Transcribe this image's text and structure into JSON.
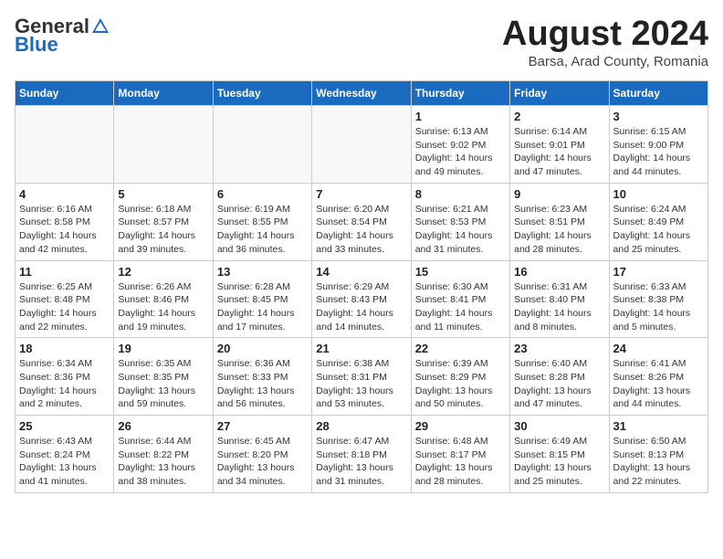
{
  "header": {
    "logo_general": "General",
    "logo_blue": "Blue",
    "month_title": "August 2024",
    "location": "Barsa, Arad County, Romania"
  },
  "columns": [
    "Sunday",
    "Monday",
    "Tuesday",
    "Wednesday",
    "Thursday",
    "Friday",
    "Saturday"
  ],
  "weeks": [
    [
      {
        "day": "",
        "info": ""
      },
      {
        "day": "",
        "info": ""
      },
      {
        "day": "",
        "info": ""
      },
      {
        "day": "",
        "info": ""
      },
      {
        "day": "1",
        "info": "Sunrise: 6:13 AM\nSunset: 9:02 PM\nDaylight: 14 hours and 49 minutes."
      },
      {
        "day": "2",
        "info": "Sunrise: 6:14 AM\nSunset: 9:01 PM\nDaylight: 14 hours and 47 minutes."
      },
      {
        "day": "3",
        "info": "Sunrise: 6:15 AM\nSunset: 9:00 PM\nDaylight: 14 hours and 44 minutes."
      }
    ],
    [
      {
        "day": "4",
        "info": "Sunrise: 6:16 AM\nSunset: 8:58 PM\nDaylight: 14 hours and 42 minutes."
      },
      {
        "day": "5",
        "info": "Sunrise: 6:18 AM\nSunset: 8:57 PM\nDaylight: 14 hours and 39 minutes."
      },
      {
        "day": "6",
        "info": "Sunrise: 6:19 AM\nSunset: 8:55 PM\nDaylight: 14 hours and 36 minutes."
      },
      {
        "day": "7",
        "info": "Sunrise: 6:20 AM\nSunset: 8:54 PM\nDaylight: 14 hours and 33 minutes."
      },
      {
        "day": "8",
        "info": "Sunrise: 6:21 AM\nSunset: 8:53 PM\nDaylight: 14 hours and 31 minutes."
      },
      {
        "day": "9",
        "info": "Sunrise: 6:23 AM\nSunset: 8:51 PM\nDaylight: 14 hours and 28 minutes."
      },
      {
        "day": "10",
        "info": "Sunrise: 6:24 AM\nSunset: 8:49 PM\nDaylight: 14 hours and 25 minutes."
      }
    ],
    [
      {
        "day": "11",
        "info": "Sunrise: 6:25 AM\nSunset: 8:48 PM\nDaylight: 14 hours and 22 minutes."
      },
      {
        "day": "12",
        "info": "Sunrise: 6:26 AM\nSunset: 8:46 PM\nDaylight: 14 hours and 19 minutes."
      },
      {
        "day": "13",
        "info": "Sunrise: 6:28 AM\nSunset: 8:45 PM\nDaylight: 14 hours and 17 minutes."
      },
      {
        "day": "14",
        "info": "Sunrise: 6:29 AM\nSunset: 8:43 PM\nDaylight: 14 hours and 14 minutes."
      },
      {
        "day": "15",
        "info": "Sunrise: 6:30 AM\nSunset: 8:41 PM\nDaylight: 14 hours and 11 minutes."
      },
      {
        "day": "16",
        "info": "Sunrise: 6:31 AM\nSunset: 8:40 PM\nDaylight: 14 hours and 8 minutes."
      },
      {
        "day": "17",
        "info": "Sunrise: 6:33 AM\nSunset: 8:38 PM\nDaylight: 14 hours and 5 minutes."
      }
    ],
    [
      {
        "day": "18",
        "info": "Sunrise: 6:34 AM\nSunset: 8:36 PM\nDaylight: 14 hours and 2 minutes."
      },
      {
        "day": "19",
        "info": "Sunrise: 6:35 AM\nSunset: 8:35 PM\nDaylight: 13 hours and 59 minutes."
      },
      {
        "day": "20",
        "info": "Sunrise: 6:36 AM\nSunset: 8:33 PM\nDaylight: 13 hours and 56 minutes."
      },
      {
        "day": "21",
        "info": "Sunrise: 6:38 AM\nSunset: 8:31 PM\nDaylight: 13 hours and 53 minutes."
      },
      {
        "day": "22",
        "info": "Sunrise: 6:39 AM\nSunset: 8:29 PM\nDaylight: 13 hours and 50 minutes."
      },
      {
        "day": "23",
        "info": "Sunrise: 6:40 AM\nSunset: 8:28 PM\nDaylight: 13 hours and 47 minutes."
      },
      {
        "day": "24",
        "info": "Sunrise: 6:41 AM\nSunset: 8:26 PM\nDaylight: 13 hours and 44 minutes."
      }
    ],
    [
      {
        "day": "25",
        "info": "Sunrise: 6:43 AM\nSunset: 8:24 PM\nDaylight: 13 hours and 41 minutes."
      },
      {
        "day": "26",
        "info": "Sunrise: 6:44 AM\nSunset: 8:22 PM\nDaylight: 13 hours and 38 minutes."
      },
      {
        "day": "27",
        "info": "Sunrise: 6:45 AM\nSunset: 8:20 PM\nDaylight: 13 hours and 34 minutes."
      },
      {
        "day": "28",
        "info": "Sunrise: 6:47 AM\nSunset: 8:18 PM\nDaylight: 13 hours and 31 minutes."
      },
      {
        "day": "29",
        "info": "Sunrise: 6:48 AM\nSunset: 8:17 PM\nDaylight: 13 hours and 28 minutes."
      },
      {
        "day": "30",
        "info": "Sunrise: 6:49 AM\nSunset: 8:15 PM\nDaylight: 13 hours and 25 minutes."
      },
      {
        "day": "31",
        "info": "Sunrise: 6:50 AM\nSunset: 8:13 PM\nDaylight: 13 hours and 22 minutes."
      }
    ]
  ]
}
